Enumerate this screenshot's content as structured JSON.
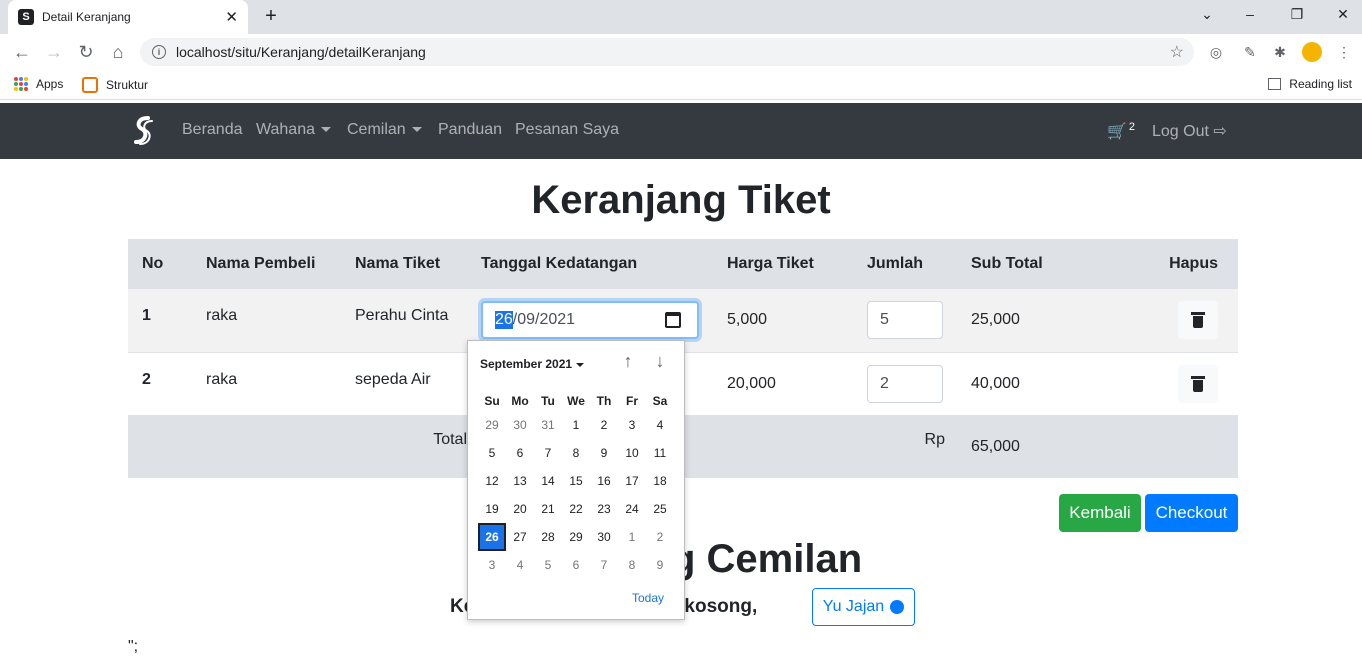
{
  "browser": {
    "tab_title": "Detail Keranjang",
    "favicon_text": "S",
    "url": "localhost/situ/Keranjang/detailKeranjang",
    "bookmarks": [
      {
        "label": "Apps"
      },
      {
        "label": "Struktur"
      }
    ],
    "reading_list": "Reading list"
  },
  "navbar": {
    "items": [
      {
        "label": "Beranda"
      },
      {
        "label": "Wahana"
      },
      {
        "label": "Cemilan"
      },
      {
        "label": "Panduan"
      },
      {
        "label": "Pesanan Saya"
      }
    ],
    "cart_count": "2",
    "logout_label": "Log Out"
  },
  "page": {
    "title": "Keranjang Tiket",
    "table": {
      "headers": [
        "No",
        "Nama Pembeli",
        "Nama Tiket",
        "Tanggal Kedatangan",
        "Harga Tiket",
        "Jumlah",
        "Sub Total",
        "Hapus"
      ],
      "rows": [
        {
          "no": "1",
          "nama_pembeli": "raka",
          "nama_tiket": "Perahu Cinta",
          "tanggal_day": "26",
          "tanggal_rest": "/09/2021",
          "harga": "5,000",
          "jumlah": "5",
          "sub_total": "25,000"
        },
        {
          "no": "2",
          "nama_pembeli": "raka",
          "nama_tiket": "sepeda Air",
          "harga": "20,000",
          "jumlah": "2",
          "sub_total": "40,000"
        }
      ],
      "total_label": "Total",
      "total_currency": "Rp",
      "total_value": "65,000"
    },
    "buttons": {
      "back": "Kembali",
      "checkout": "Checkout"
    },
    "cemilan_title": "Keranjang Cemilan",
    "cemilan_empty": "Keranjang cemilan masih kosong,",
    "yu_jajan": "Yu Jajan",
    "stray_text": "\";"
  },
  "datepicker": {
    "month_label": "September 2021",
    "weekdays": [
      "Su",
      "Mo",
      "Tu",
      "We",
      "Th",
      "Fr",
      "Sa"
    ],
    "weeks": [
      [
        "29",
        "30",
        "31",
        "1",
        "2",
        "3",
        "4"
      ],
      [
        "5",
        "6",
        "7",
        "8",
        "9",
        "10",
        "11"
      ],
      [
        "12",
        "13",
        "14",
        "15",
        "16",
        "17",
        "18"
      ],
      [
        "19",
        "20",
        "21",
        "22",
        "23",
        "24",
        "25"
      ],
      [
        "26",
        "27",
        "28",
        "29",
        "30",
        "1",
        "2"
      ],
      [
        "3",
        "4",
        "5",
        "6",
        "7",
        "8",
        "9"
      ]
    ],
    "selected": "26",
    "today_label": "Today",
    "up_arrow": "↑",
    "down_arrow": "↓"
  },
  "colors": {
    "navbar_bg": "#343a40",
    "success": "#28a745",
    "primary": "#007bff",
    "picker_accent": "#1a73e8"
  }
}
